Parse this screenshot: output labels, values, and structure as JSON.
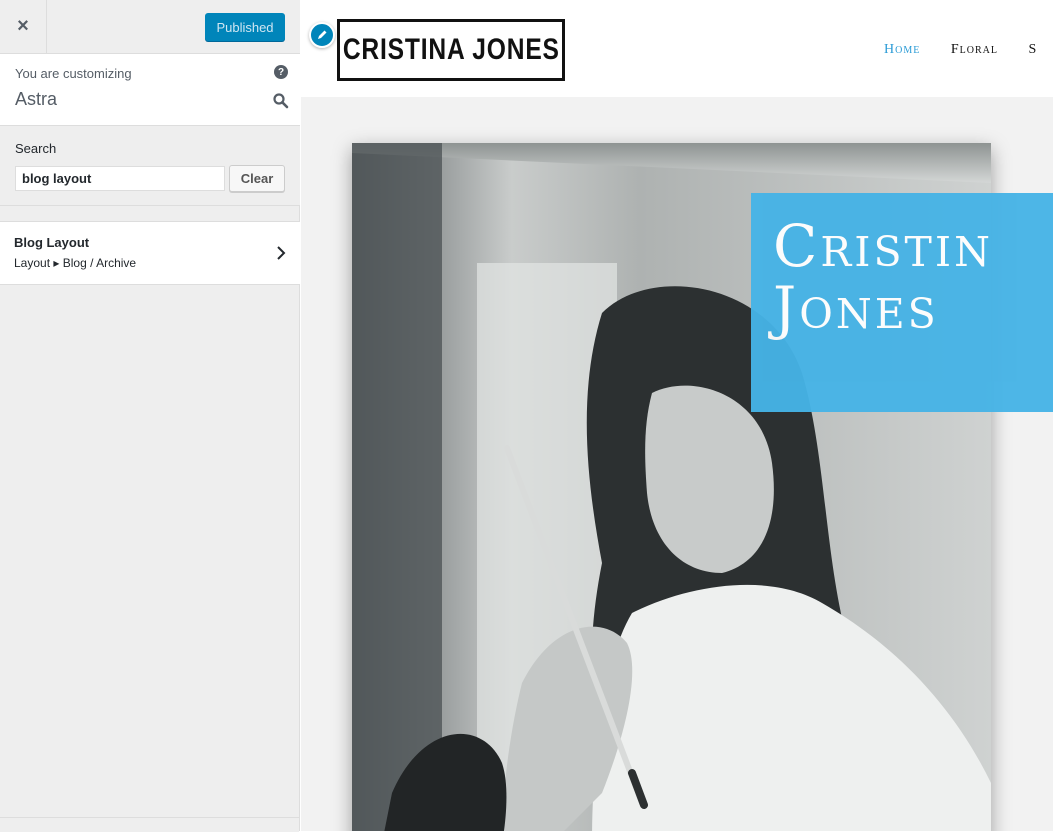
{
  "sidebar": {
    "close_label": "×",
    "publish_label": "Published",
    "info": {
      "caption": "You are customizing",
      "theme": "Astra",
      "help_glyph": "?"
    },
    "search": {
      "label": "Search",
      "value": "blog layout",
      "clear_label": "Clear"
    },
    "results": [
      {
        "title": "Blog Layout",
        "path": "Layout ▸ Blog / Archive"
      }
    ]
  },
  "preview": {
    "logo_text": "CRISTINA JONES",
    "nav": [
      "Home",
      "Floral",
      "S"
    ],
    "hero_title": "Cristin\nJones"
  },
  "colors": {
    "accent": "#0085ba",
    "nav_active": "#2a9bd6",
    "hero_box": "#46b3e6"
  }
}
